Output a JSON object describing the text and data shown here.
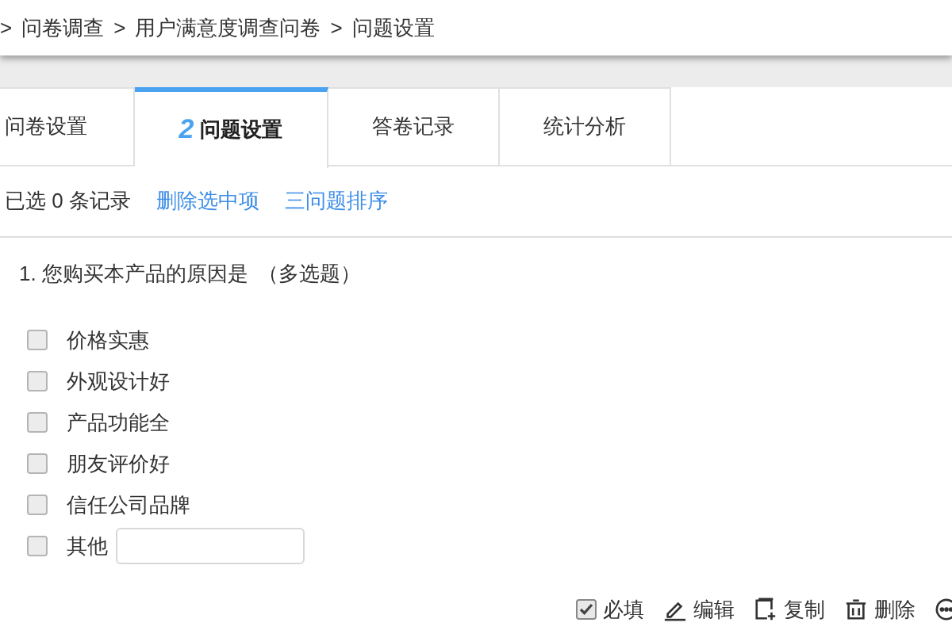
{
  "breadcrumb": [
    {
      "label": "问卷调查"
    },
    {
      "label": "用户满意度调查问卷"
    },
    {
      "label": "问题设置"
    }
  ],
  "breadcrumb_separator": ">",
  "tabs": [
    {
      "label": "问卷设置",
      "selected": false
    },
    {
      "number": "2",
      "label": "问题设置",
      "selected": true
    },
    {
      "label": "答卷记录",
      "selected": false
    },
    {
      "label": "统计分析",
      "selected": false
    }
  ],
  "toolbar": {
    "selected_count": "已选 0 条记录",
    "actions": [
      "删除选中项",
      "三问题排序"
    ]
  },
  "question": {
    "title": "1. 您购买本产品的原因是",
    "type": "（多选题）",
    "options": [
      {
        "kind": "checkbox",
        "label": "价格实惠",
        "checked": false
      },
      {
        "kind": "checkbox",
        "label": "外观设计好",
        "checked": false
      },
      {
        "kind": "checkbox",
        "label": "产品功能全",
        "checked": false
      },
      {
        "kind": "checkbox",
        "label": "朋友评价好",
        "checked": false
      },
      {
        "kind": "checkbox",
        "label": "信任公司品牌",
        "checked": false
      },
      {
        "kind": "other",
        "label": "其他",
        "checked": false
      }
    ],
    "required": {
      "label": "必填",
      "checked": true
    },
    "actions": [
      {
        "kind": "edit",
        "label": "编辑"
      },
      {
        "kind": "copy",
        "label": "复制"
      },
      {
        "kind": "delete",
        "label": "删除"
      },
      {
        "kind": "more"
      }
    ]
  }
}
